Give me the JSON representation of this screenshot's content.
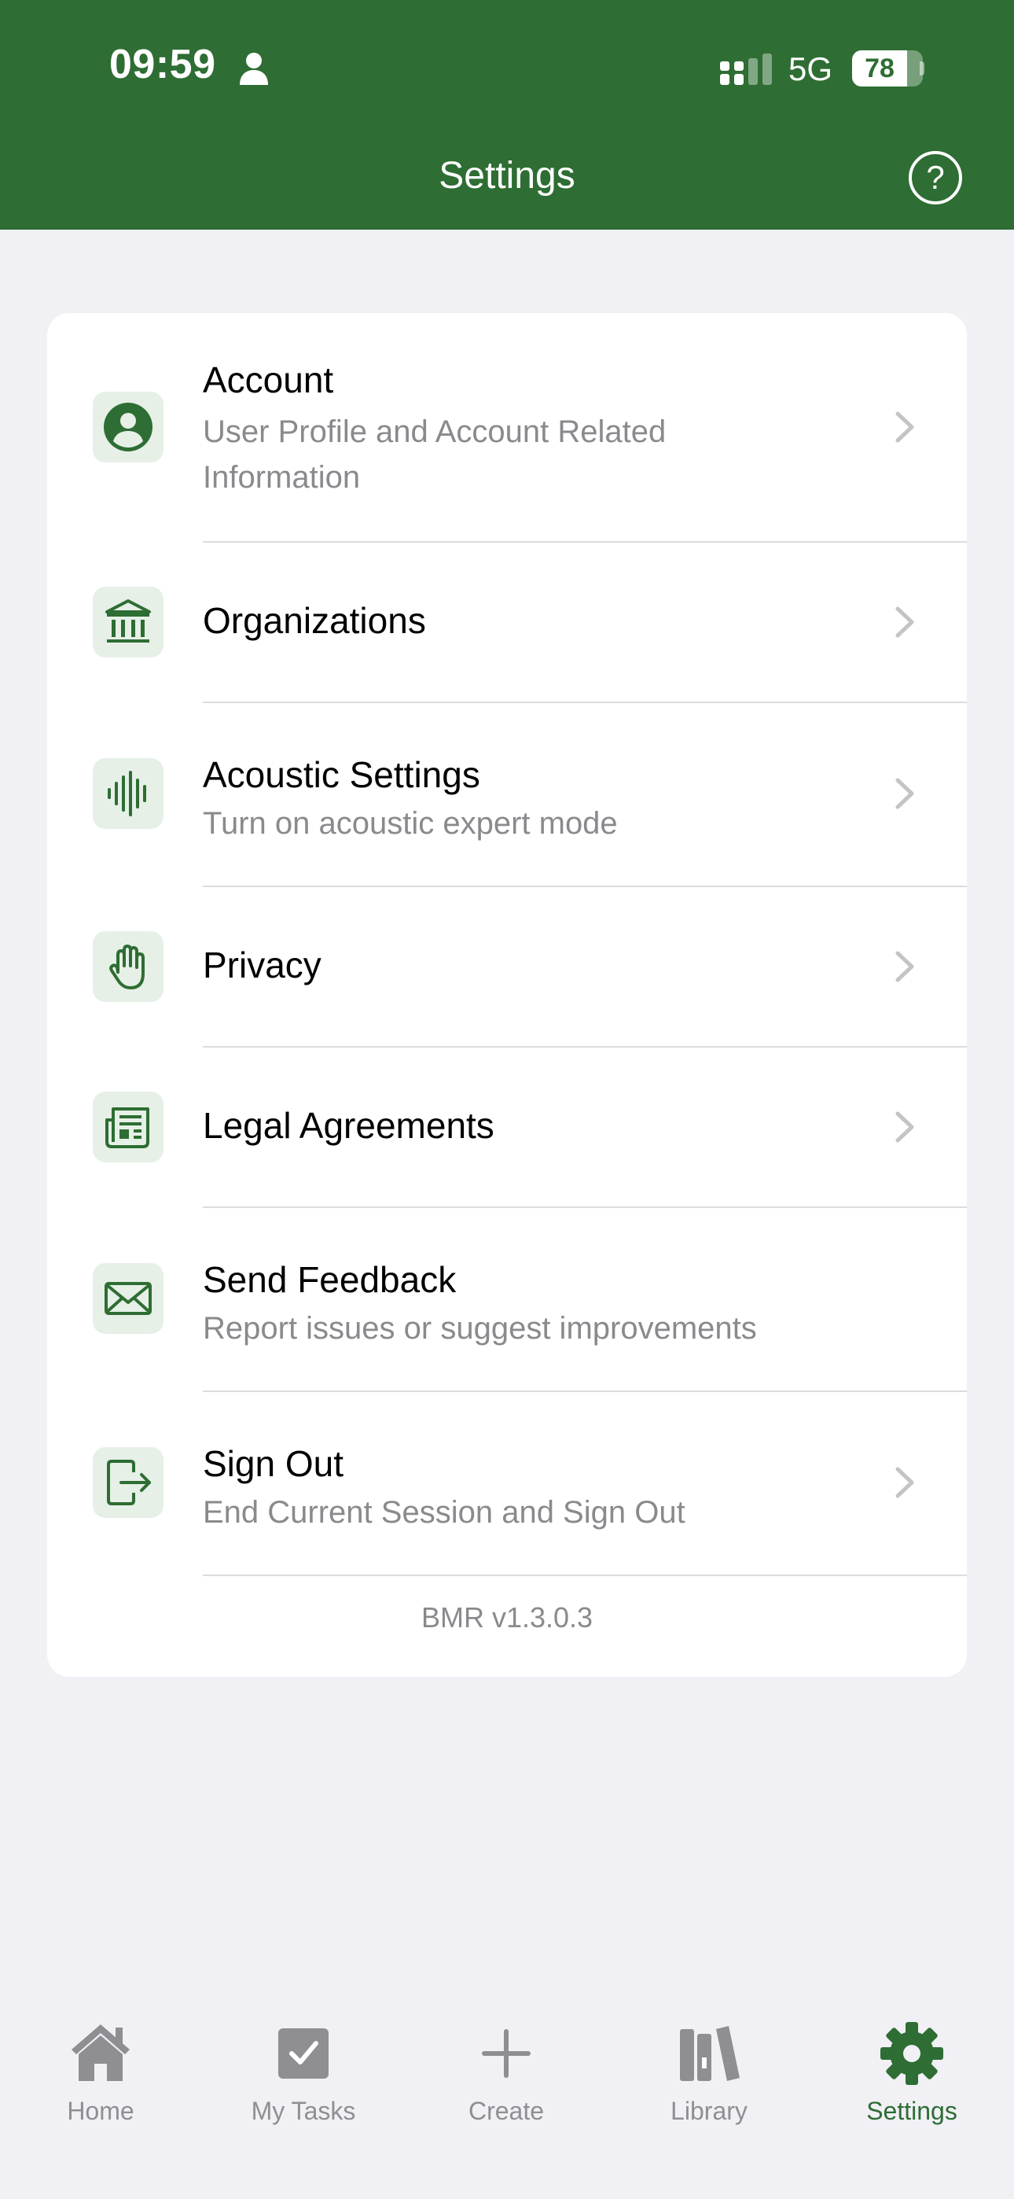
{
  "status_bar": {
    "time": "09:59",
    "network": "5G",
    "battery": "78",
    "battery_level": 0.78
  },
  "header": {
    "title": "Settings",
    "help_label": "?"
  },
  "settings": {
    "items": [
      {
        "title": "Account",
        "subtitle_line1": "User Profile and Account Related",
        "subtitle_line2": "Information",
        "icon": "person-circle-icon",
        "chevron": true
      },
      {
        "title": "Organizations",
        "icon": "bank-building-icon",
        "chevron": true
      },
      {
        "title": "Acoustic Settings",
        "subtitle": "Turn on acoustic expert mode",
        "icon": "waveform-icon",
        "chevron": true
      },
      {
        "title": "Privacy",
        "icon": "hand-raised-icon",
        "chevron": true
      },
      {
        "title": "Legal Agreements",
        "icon": "newspaper-icon",
        "chevron": true
      },
      {
        "title": "Send Feedback",
        "subtitle": "Report issues or suggest improvements",
        "icon": "envelope-icon",
        "chevron": false
      },
      {
        "title": "Sign Out",
        "subtitle": "End Current Session and Sign Out",
        "icon": "sign-out-icon",
        "chevron": true
      }
    ],
    "version": "BMR v1.3.0.3"
  },
  "tabbar": {
    "tabs": [
      {
        "label": "Home",
        "icon": "house-icon",
        "active": false
      },
      {
        "label": "My Tasks",
        "icon": "checkbox-icon",
        "active": false
      },
      {
        "label": "Create",
        "icon": "plus-icon",
        "active": false
      },
      {
        "label": "Library",
        "icon": "books-icon",
        "active": false
      },
      {
        "label": "Settings",
        "icon": "gear-icon",
        "active": true
      }
    ]
  },
  "colors": {
    "brand": "#2e6d33",
    "icon_bg": "#e6f0e7",
    "background": "#f0f0f5",
    "secondary_text": "#8a8a8e",
    "inactive_tab": "#8e8e93"
  }
}
